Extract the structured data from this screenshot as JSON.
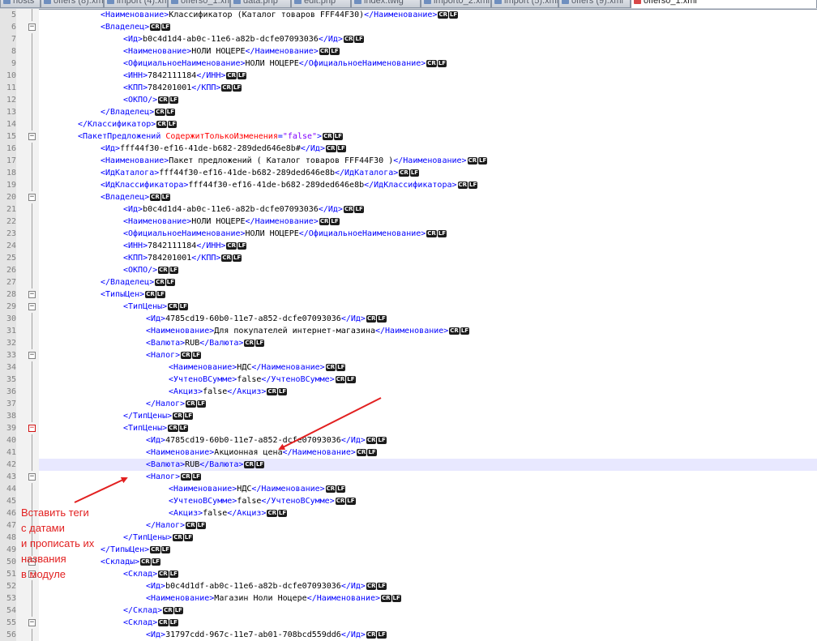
{
  "tabs": [
    {
      "label": "hosts",
      "active": false
    },
    {
      "label": "offers (8).xml",
      "active": false
    },
    {
      "label": "import (4).xml",
      "active": false
    },
    {
      "label": "offers0_1.xml",
      "active": false
    },
    {
      "label": "data.php",
      "active": false
    },
    {
      "label": "edit.php",
      "active": false
    },
    {
      "label": "index.twig",
      "active": false
    },
    {
      "label": "import0_2.xml",
      "active": false
    },
    {
      "label": "import (5).xml",
      "active": false
    },
    {
      "label": "offers (9).xml",
      "active": false
    },
    {
      "label": "offers0_1.xml",
      "active": true
    }
  ],
  "eol_marker": [
    "CR",
    "LF"
  ],
  "editor": {
    "first_line": 5,
    "current_line": 42,
    "lines": [
      {
        "indent": 3,
        "tokens": [
          [
            "tag",
            "<Наименование>"
          ],
          [
            "txt",
            "Классификатор (Каталог товаров FFF44F30)"
          ],
          [
            "tag",
            "</Наименование>"
          ]
        ]
      },
      {
        "indent": 3,
        "fold": "open",
        "tokens": [
          [
            "tag",
            "<Владелец>"
          ]
        ]
      },
      {
        "indent": 4,
        "tokens": [
          [
            "tag",
            "<Ид>"
          ],
          [
            "txt",
            "b0c4d1d4-ab0c-11e6-a82b-dcfe07093036"
          ],
          [
            "tag",
            "</Ид>"
          ]
        ]
      },
      {
        "indent": 4,
        "tokens": [
          [
            "tag",
            "<Наименование>"
          ],
          [
            "txt",
            "НОЛИ НОЦЕРЕ"
          ],
          [
            "tag",
            "</Наименование>"
          ]
        ]
      },
      {
        "indent": 4,
        "tokens": [
          [
            "tag",
            "<ОфициальноеНаименование>"
          ],
          [
            "txt",
            "НОЛИ НОЦЕРЕ"
          ],
          [
            "tag",
            "</ОфициальноеНаименование>"
          ]
        ]
      },
      {
        "indent": 4,
        "tokens": [
          [
            "tag",
            "<ИНН>"
          ],
          [
            "txt",
            "7842111184"
          ],
          [
            "tag",
            "</ИНН>"
          ]
        ]
      },
      {
        "indent": 4,
        "tokens": [
          [
            "tag",
            "<КПП>"
          ],
          [
            "txt",
            "784201001"
          ],
          [
            "tag",
            "</КПП>"
          ]
        ]
      },
      {
        "indent": 4,
        "tokens": [
          [
            "tag",
            "<ОКПО/>"
          ]
        ]
      },
      {
        "indent": 3,
        "tokens": [
          [
            "tag",
            "</Владелец>"
          ]
        ]
      },
      {
        "indent": 2,
        "tokens": [
          [
            "tag",
            "</Классификатор>"
          ]
        ]
      },
      {
        "indent": 2,
        "fold": "open",
        "tokens": [
          [
            "tag",
            "<ПакетПредложений "
          ],
          [
            "attr",
            "СодержитТолькоИзменения"
          ],
          [
            "tag",
            "="
          ],
          [
            "val",
            "\"false\""
          ],
          [
            "tag",
            ">"
          ]
        ]
      },
      {
        "indent": 3,
        "tokens": [
          [
            "tag",
            "<Ид>"
          ],
          [
            "txt",
            "fff44f30-ef16-41de-b682-289ded646e8b#"
          ],
          [
            "tag",
            "</Ид>"
          ]
        ]
      },
      {
        "indent": 3,
        "tokens": [
          [
            "tag",
            "<Наименование>"
          ],
          [
            "txt",
            "Пакет предложений ( Каталог товаров FFF44F30 )"
          ],
          [
            "tag",
            "</Наименование>"
          ]
        ]
      },
      {
        "indent": 3,
        "tokens": [
          [
            "tag",
            "<ИдКаталога>"
          ],
          [
            "txt",
            "fff44f30-ef16-41de-b682-289ded646e8b"
          ],
          [
            "tag",
            "</ИдКаталога>"
          ]
        ]
      },
      {
        "indent": 3,
        "tokens": [
          [
            "tag",
            "<ИдКлассификатора>"
          ],
          [
            "txt",
            "fff44f30-ef16-41de-b682-289ded646e8b"
          ],
          [
            "tag",
            "</ИдКлассификатора>"
          ]
        ]
      },
      {
        "indent": 3,
        "fold": "open",
        "tokens": [
          [
            "tag",
            "<Владелец>"
          ]
        ]
      },
      {
        "indent": 4,
        "tokens": [
          [
            "tag",
            "<Ид>"
          ],
          [
            "txt",
            "b0c4d1d4-ab0c-11e6-a82b-dcfe07093036"
          ],
          [
            "tag",
            "</Ид>"
          ]
        ]
      },
      {
        "indent": 4,
        "tokens": [
          [
            "tag",
            "<Наименование>"
          ],
          [
            "txt",
            "НОЛИ НОЦЕРЕ"
          ],
          [
            "tag",
            "</Наименование>"
          ]
        ]
      },
      {
        "indent": 4,
        "tokens": [
          [
            "tag",
            "<ОфициальноеНаименование>"
          ],
          [
            "txt",
            "НОЛИ НОЦЕРЕ"
          ],
          [
            "tag",
            "</ОфициальноеНаименование>"
          ]
        ]
      },
      {
        "indent": 4,
        "tokens": [
          [
            "tag",
            "<ИНН>"
          ],
          [
            "txt",
            "7842111184"
          ],
          [
            "tag",
            "</ИНН>"
          ]
        ]
      },
      {
        "indent": 4,
        "tokens": [
          [
            "tag",
            "<КПП>"
          ],
          [
            "txt",
            "784201001"
          ],
          [
            "tag",
            "</КПП>"
          ]
        ]
      },
      {
        "indent": 4,
        "tokens": [
          [
            "tag",
            "<ОКПО/>"
          ]
        ]
      },
      {
        "indent": 3,
        "tokens": [
          [
            "tag",
            "</Владелец>"
          ]
        ]
      },
      {
        "indent": 3,
        "fold": "open",
        "tokens": [
          [
            "tag",
            "<ТипыЦен>"
          ]
        ]
      },
      {
        "indent": 4,
        "fold": "open",
        "tokens": [
          [
            "tag",
            "<ТипЦены>"
          ]
        ]
      },
      {
        "indent": 5,
        "tokens": [
          [
            "tag",
            "<Ид>"
          ],
          [
            "txt",
            "4785cd19-60b0-11e7-a852-dcfe07093036"
          ],
          [
            "tag",
            "</Ид>"
          ]
        ]
      },
      {
        "indent": 5,
        "tokens": [
          [
            "tag",
            "<Наименование>"
          ],
          [
            "txt",
            "Для покупателей интернет-магазина"
          ],
          [
            "tag",
            "</Наименование>"
          ]
        ]
      },
      {
        "indent": 5,
        "tokens": [
          [
            "tag",
            "<Валюта>"
          ],
          [
            "txt",
            "RUB"
          ],
          [
            "tag",
            "</Валюта>"
          ]
        ]
      },
      {
        "indent": 5,
        "fold": "open",
        "tokens": [
          [
            "tag",
            "<Налог>"
          ]
        ]
      },
      {
        "indent": 6,
        "tokens": [
          [
            "tag",
            "<Наименование>"
          ],
          [
            "txt",
            "НДС"
          ],
          [
            "tag",
            "</Наименование>"
          ]
        ]
      },
      {
        "indent": 6,
        "tokens": [
          [
            "tag",
            "<УчтеноВСумме>"
          ],
          [
            "txt",
            "false"
          ],
          [
            "tag",
            "</УчтеноВСумме>"
          ]
        ]
      },
      {
        "indent": 6,
        "tokens": [
          [
            "tag",
            "<Акциз>"
          ],
          [
            "txt",
            "false"
          ],
          [
            "tag",
            "</Акциз>"
          ]
        ]
      },
      {
        "indent": 5,
        "tokens": [
          [
            "tag",
            "</Налог>"
          ]
        ]
      },
      {
        "indent": 4,
        "tokens": [
          [
            "tag",
            "</ТипЦены>"
          ]
        ]
      },
      {
        "indent": 4,
        "fold": "red",
        "tokens": [
          [
            "tag",
            "<ТипЦены>"
          ]
        ]
      },
      {
        "indent": 5,
        "tokens": [
          [
            "tag",
            "<Ид>"
          ],
          [
            "txt",
            "4785cd19-60b0-11e7-a852-dcfe07093036"
          ],
          [
            "tag",
            "</Ид>"
          ]
        ]
      },
      {
        "indent": 5,
        "tokens": [
          [
            "tag",
            "<Наименование>"
          ],
          [
            "txt",
            "Акционная цена"
          ],
          [
            "tag",
            "</Наименование>"
          ]
        ]
      },
      {
        "indent": 5,
        "tokens": [
          [
            "tag",
            "<Валюта>"
          ],
          [
            "txt",
            "RUB"
          ],
          [
            "tag",
            "</Валюта>"
          ]
        ]
      },
      {
        "indent": 5,
        "fold": "open",
        "tokens": [
          [
            "tag",
            "<Налог>"
          ]
        ]
      },
      {
        "indent": 6,
        "tokens": [
          [
            "tag",
            "<Наименование>"
          ],
          [
            "txt",
            "НДС"
          ],
          [
            "tag",
            "</Наименование>"
          ]
        ]
      },
      {
        "indent": 6,
        "tokens": [
          [
            "tag",
            "<УчтеноВСумме>"
          ],
          [
            "txt",
            "false"
          ],
          [
            "tag",
            "</УчтеноВСумме>"
          ]
        ]
      },
      {
        "indent": 6,
        "tokens": [
          [
            "tag",
            "<Акциз>"
          ],
          [
            "txt",
            "false"
          ],
          [
            "tag",
            "</Акциз>"
          ]
        ]
      },
      {
        "indent": 5,
        "tokens": [
          [
            "tag",
            "</Налог>"
          ]
        ]
      },
      {
        "indent": 4,
        "tokens": [
          [
            "tag",
            "</ТипЦены>"
          ]
        ]
      },
      {
        "indent": 3,
        "tokens": [
          [
            "tag",
            "</ТипыЦен>"
          ]
        ]
      },
      {
        "indent": 3,
        "fold": "open",
        "tokens": [
          [
            "tag",
            "<Склады>"
          ]
        ]
      },
      {
        "indent": 4,
        "fold": "open",
        "tokens": [
          [
            "tag",
            "<Склад>"
          ]
        ]
      },
      {
        "indent": 5,
        "tokens": [
          [
            "tag",
            "<Ид>"
          ],
          [
            "txt",
            "b0c4d1df-ab0c-11e6-a82b-dcfe07093036"
          ],
          [
            "tag",
            "</Ид>"
          ]
        ]
      },
      {
        "indent": 5,
        "tokens": [
          [
            "tag",
            "<Наименование>"
          ],
          [
            "txt",
            "Магазин Ноли Ноцере"
          ],
          [
            "tag",
            "</Наименование>"
          ]
        ]
      },
      {
        "indent": 4,
        "tokens": [
          [
            "tag",
            "</Склад>"
          ]
        ]
      },
      {
        "indent": 4,
        "fold": "open",
        "tokens": [
          [
            "tag",
            "<Склад>"
          ]
        ]
      },
      {
        "indent": 5,
        "tokens": [
          [
            "tag",
            "<Ид>"
          ],
          [
            "txt",
            "31797cdd-967c-11e7-ab01-708bcd559dd6"
          ],
          [
            "tag",
            "</Ид>"
          ]
        ]
      }
    ]
  },
  "annotation": {
    "lines": [
      "Вставить теги",
      "с датами",
      "и прописать их",
      "названия",
      "в модуле"
    ],
    "color": "#e22020"
  },
  "colors": {
    "tag": "#0000ff",
    "attribute": "#ff0000",
    "attribute_value": "#8000ff",
    "text": "#000000",
    "current_line": "#e8e8ff"
  }
}
